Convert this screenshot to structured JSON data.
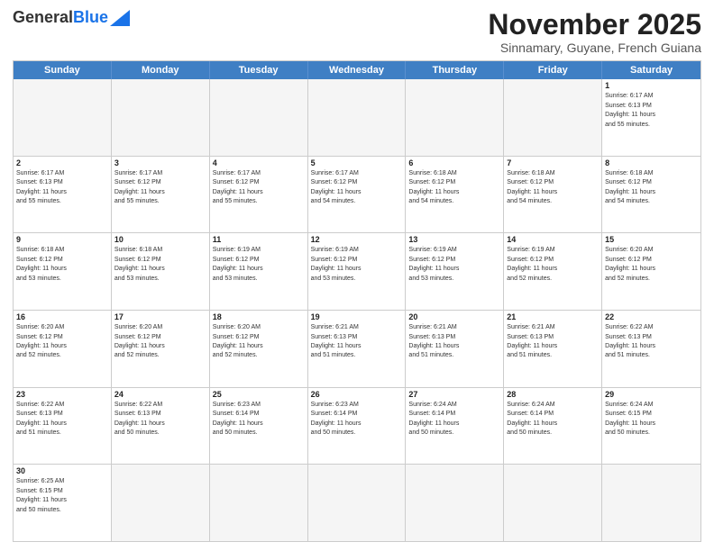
{
  "header": {
    "logo_general": "General",
    "logo_blue": "Blue",
    "month_title": "November 2025",
    "subtitle": "Sinnamary, Guyane, French Guiana"
  },
  "weekdays": [
    "Sunday",
    "Monday",
    "Tuesday",
    "Wednesday",
    "Thursday",
    "Friday",
    "Saturday"
  ],
  "weeks": [
    [
      {
        "day": "",
        "info": ""
      },
      {
        "day": "",
        "info": ""
      },
      {
        "day": "",
        "info": ""
      },
      {
        "day": "",
        "info": ""
      },
      {
        "day": "",
        "info": ""
      },
      {
        "day": "",
        "info": ""
      },
      {
        "day": "1",
        "info": "Sunrise: 6:17 AM\nSunset: 6:13 PM\nDaylight: 11 hours\nand 55 minutes."
      }
    ],
    [
      {
        "day": "2",
        "info": "Sunrise: 6:17 AM\nSunset: 6:13 PM\nDaylight: 11 hours\nand 55 minutes."
      },
      {
        "day": "3",
        "info": "Sunrise: 6:17 AM\nSunset: 6:12 PM\nDaylight: 11 hours\nand 55 minutes."
      },
      {
        "day": "4",
        "info": "Sunrise: 6:17 AM\nSunset: 6:12 PM\nDaylight: 11 hours\nand 55 minutes."
      },
      {
        "day": "5",
        "info": "Sunrise: 6:17 AM\nSunset: 6:12 PM\nDaylight: 11 hours\nand 54 minutes."
      },
      {
        "day": "6",
        "info": "Sunrise: 6:18 AM\nSunset: 6:12 PM\nDaylight: 11 hours\nand 54 minutes."
      },
      {
        "day": "7",
        "info": "Sunrise: 6:18 AM\nSunset: 6:12 PM\nDaylight: 11 hours\nand 54 minutes."
      },
      {
        "day": "8",
        "info": "Sunrise: 6:18 AM\nSunset: 6:12 PM\nDaylight: 11 hours\nand 54 minutes."
      }
    ],
    [
      {
        "day": "9",
        "info": "Sunrise: 6:18 AM\nSunset: 6:12 PM\nDaylight: 11 hours\nand 53 minutes."
      },
      {
        "day": "10",
        "info": "Sunrise: 6:18 AM\nSunset: 6:12 PM\nDaylight: 11 hours\nand 53 minutes."
      },
      {
        "day": "11",
        "info": "Sunrise: 6:19 AM\nSunset: 6:12 PM\nDaylight: 11 hours\nand 53 minutes."
      },
      {
        "day": "12",
        "info": "Sunrise: 6:19 AM\nSunset: 6:12 PM\nDaylight: 11 hours\nand 53 minutes."
      },
      {
        "day": "13",
        "info": "Sunrise: 6:19 AM\nSunset: 6:12 PM\nDaylight: 11 hours\nand 53 minutes."
      },
      {
        "day": "14",
        "info": "Sunrise: 6:19 AM\nSunset: 6:12 PM\nDaylight: 11 hours\nand 52 minutes."
      },
      {
        "day": "15",
        "info": "Sunrise: 6:20 AM\nSunset: 6:12 PM\nDaylight: 11 hours\nand 52 minutes."
      }
    ],
    [
      {
        "day": "16",
        "info": "Sunrise: 6:20 AM\nSunset: 6:12 PM\nDaylight: 11 hours\nand 52 minutes."
      },
      {
        "day": "17",
        "info": "Sunrise: 6:20 AM\nSunset: 6:12 PM\nDaylight: 11 hours\nand 52 minutes."
      },
      {
        "day": "18",
        "info": "Sunrise: 6:20 AM\nSunset: 6:12 PM\nDaylight: 11 hours\nand 52 minutes."
      },
      {
        "day": "19",
        "info": "Sunrise: 6:21 AM\nSunset: 6:13 PM\nDaylight: 11 hours\nand 51 minutes."
      },
      {
        "day": "20",
        "info": "Sunrise: 6:21 AM\nSunset: 6:13 PM\nDaylight: 11 hours\nand 51 minutes."
      },
      {
        "day": "21",
        "info": "Sunrise: 6:21 AM\nSunset: 6:13 PM\nDaylight: 11 hours\nand 51 minutes."
      },
      {
        "day": "22",
        "info": "Sunrise: 6:22 AM\nSunset: 6:13 PM\nDaylight: 11 hours\nand 51 minutes."
      }
    ],
    [
      {
        "day": "23",
        "info": "Sunrise: 6:22 AM\nSunset: 6:13 PM\nDaylight: 11 hours\nand 51 minutes."
      },
      {
        "day": "24",
        "info": "Sunrise: 6:22 AM\nSunset: 6:13 PM\nDaylight: 11 hours\nand 50 minutes."
      },
      {
        "day": "25",
        "info": "Sunrise: 6:23 AM\nSunset: 6:14 PM\nDaylight: 11 hours\nand 50 minutes."
      },
      {
        "day": "26",
        "info": "Sunrise: 6:23 AM\nSunset: 6:14 PM\nDaylight: 11 hours\nand 50 minutes."
      },
      {
        "day": "27",
        "info": "Sunrise: 6:24 AM\nSunset: 6:14 PM\nDaylight: 11 hours\nand 50 minutes."
      },
      {
        "day": "28",
        "info": "Sunrise: 6:24 AM\nSunset: 6:14 PM\nDaylight: 11 hours\nand 50 minutes."
      },
      {
        "day": "29",
        "info": "Sunrise: 6:24 AM\nSunset: 6:15 PM\nDaylight: 11 hours\nand 50 minutes."
      }
    ],
    [
      {
        "day": "30",
        "info": "Sunrise: 6:25 AM\nSunset: 6:15 PM\nDaylight: 11 hours\nand 50 minutes."
      },
      {
        "day": "",
        "info": ""
      },
      {
        "day": "",
        "info": ""
      },
      {
        "day": "",
        "info": ""
      },
      {
        "day": "",
        "info": ""
      },
      {
        "day": "",
        "info": ""
      },
      {
        "day": "",
        "info": ""
      }
    ]
  ]
}
